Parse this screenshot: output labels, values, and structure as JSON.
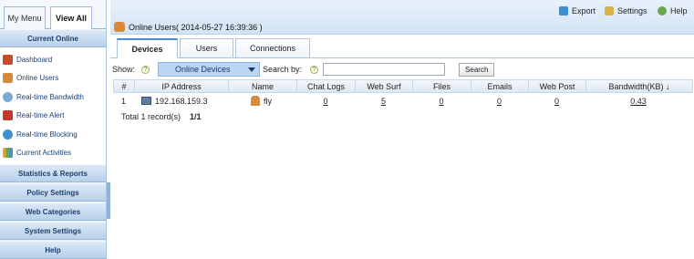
{
  "sidebar": {
    "tabs": [
      "My Menu",
      "View All"
    ],
    "current_online_title": "Current Online",
    "items": [
      {
        "label": "Dashboard",
        "icon": "dashboard-icon",
        "color": "#c94a2b"
      },
      {
        "label": "Online Users",
        "icon": "users-icon",
        "color": "#d68a3a"
      },
      {
        "label": "Real-time Bandwidth",
        "icon": "bandwidth-icon",
        "color": "#7aa9d8"
      },
      {
        "label": "Real-time Alert",
        "icon": "alert-icon",
        "color": "#c9372c"
      },
      {
        "label": "Real-time Blocking",
        "icon": "blocking-icon",
        "color": "#3f8fd4"
      },
      {
        "label": "Current Activities",
        "icon": "activities-icon",
        "color": "#e0a53a"
      }
    ],
    "sections": [
      "Statistics & Reports",
      "Policy Settings",
      "Web Categories",
      "System Settings",
      "Help"
    ]
  },
  "header": {
    "export_label": "Export",
    "settings_label": "Settings",
    "help_label": "Help",
    "page_title": "Online Users( 2014-05-27 16:39:36 )"
  },
  "content_tabs": [
    "Devices",
    "Users",
    "Connections"
  ],
  "filter": {
    "show_label": "Show:",
    "show_value": "Online Devices",
    "search_label": "Search by:",
    "search_value": "",
    "search_button": "Search"
  },
  "table": {
    "columns": [
      "#",
      "IP Address",
      "Name",
      "Chat Logs",
      "Web Surf",
      "Files",
      "Emails",
      "Web Post",
      "Bandwidth(KB) ↓"
    ],
    "rows": [
      {
        "num": "1",
        "ip": "192.168.159.3",
        "name": "fly",
        "chat": "0",
        "websurf": "5",
        "files": "0",
        "emails": "0",
        "webpost": "0",
        "bandwidth": "0.43"
      }
    ]
  },
  "footer": {
    "total": "Total 1 record(s)",
    "pages": "1/1"
  },
  "colors": {
    "accent": "#4b8ccd",
    "sidebar_bg": "#e9f2fb",
    "select_bg": "#b9d6f4"
  }
}
